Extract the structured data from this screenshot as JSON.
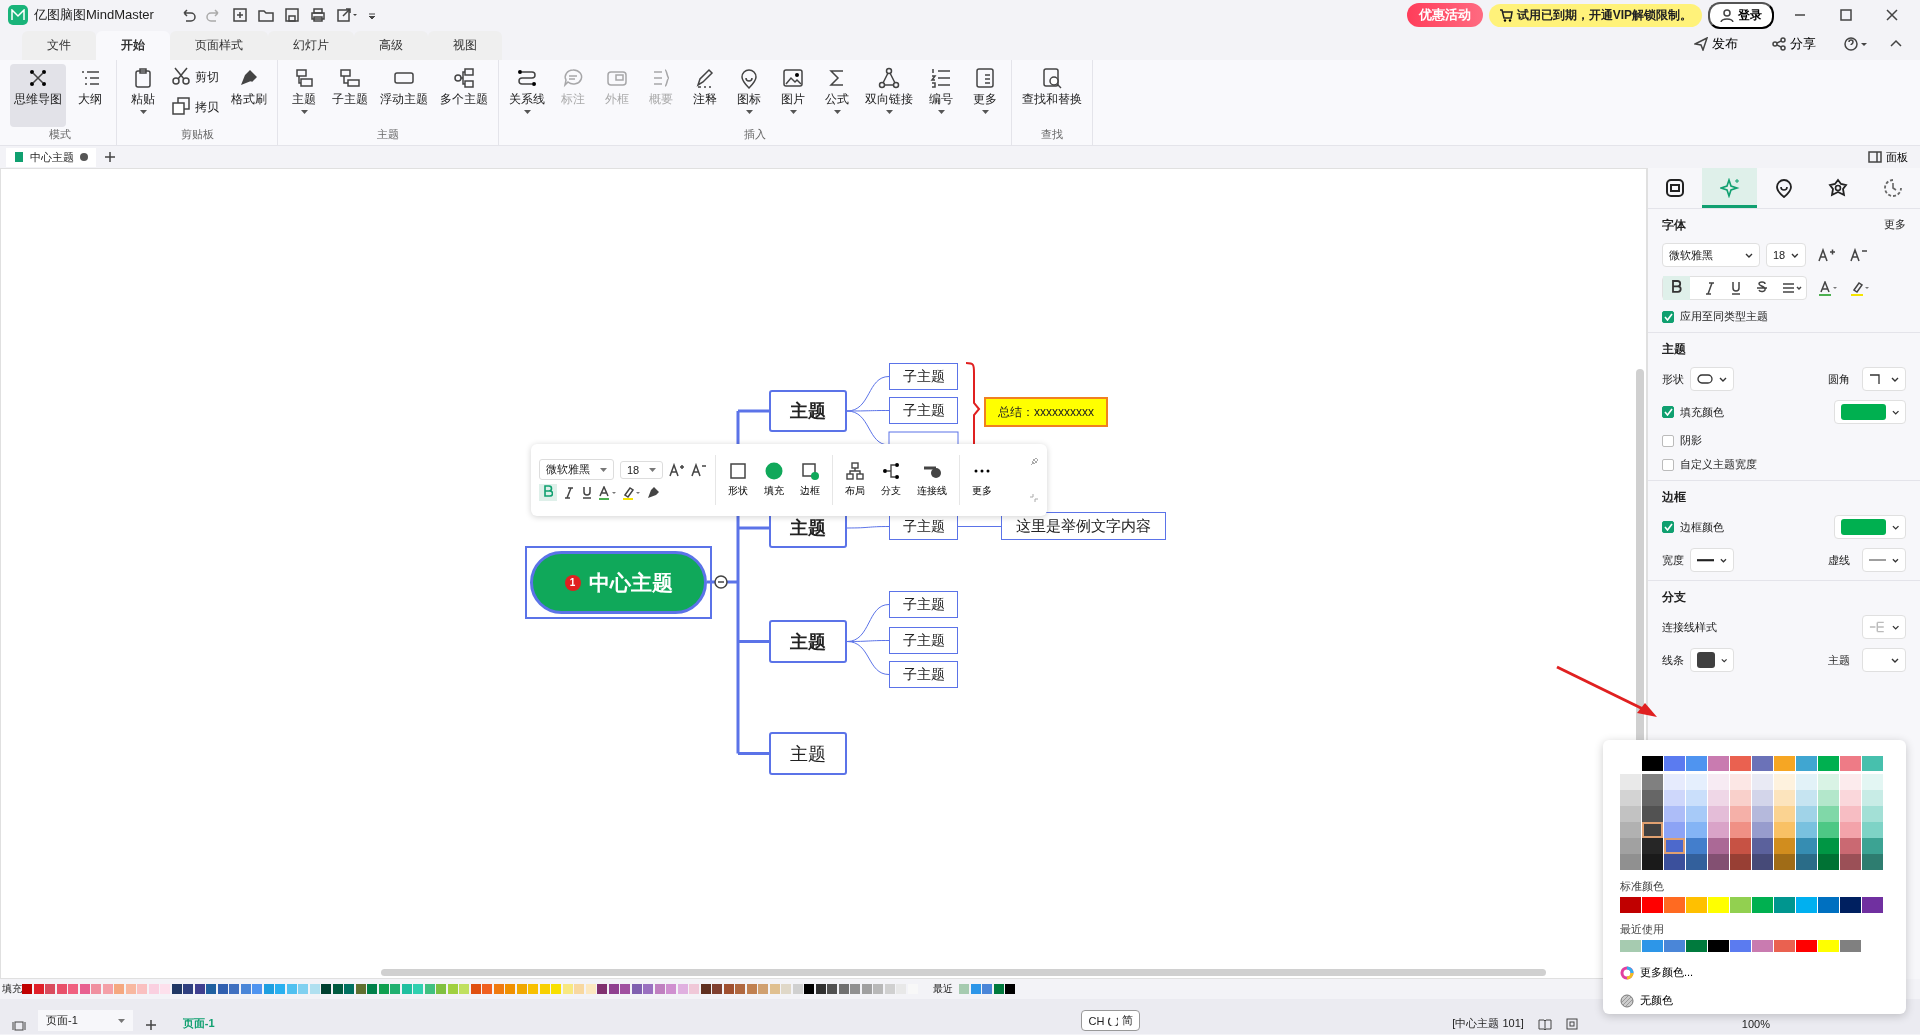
{
  "app": {
    "title": "亿图脑图MindMaster",
    "promo": "优惠活动",
    "trial": "试用已到期，开通VIP解锁限制。",
    "login": "登录",
    "publish": "发布",
    "share": "分享"
  },
  "menu": [
    {
      "label": "文件",
      "selected": false
    },
    {
      "label": "开始",
      "selected": true
    },
    {
      "label": "页面样式",
      "selected": false
    },
    {
      "label": "幻灯片",
      "selected": false
    },
    {
      "label": "高级",
      "selected": false
    },
    {
      "label": "视图",
      "selected": false
    }
  ],
  "ribbon": [
    {
      "label": "模式",
      "buttons": [
        {
          "label": "思维导图",
          "kind": "large",
          "selected": true,
          "disabled": false,
          "dropdown": false
        },
        {
          "label": "大纲",
          "kind": "large",
          "selected": false,
          "disabled": false,
          "dropdown": false
        }
      ]
    },
    {
      "label": "剪贴板",
      "buttons": [
        {
          "label": "粘贴",
          "kind": "large",
          "selected": false,
          "disabled": false,
          "dropdown": true
        },
        {
          "label": "剪切",
          "kind": "small",
          "selected": false,
          "disabled": false,
          "dropdown": false
        },
        {
          "label": "拷贝",
          "kind": "small",
          "selected": false,
          "disabled": false,
          "dropdown": false
        },
        {
          "label": "格式刷",
          "kind": "large",
          "selected": false,
          "disabled": false,
          "dropdown": false
        }
      ]
    },
    {
      "label": "主题",
      "buttons": [
        {
          "label": "主题",
          "kind": "large",
          "selected": false,
          "disabled": false,
          "dropdown": true
        },
        {
          "label": "子主题",
          "kind": "large",
          "selected": false,
          "disabled": false,
          "dropdown": false
        },
        {
          "label": "浮动主题",
          "kind": "large",
          "selected": false,
          "disabled": false,
          "dropdown": false
        },
        {
          "label": "多个主题",
          "kind": "large",
          "selected": false,
          "disabled": false,
          "dropdown": false
        }
      ]
    },
    {
      "label": "插入",
      "buttons": [
        {
          "label": "关系线",
          "kind": "large",
          "selected": false,
          "disabled": false,
          "dropdown": true
        },
        {
          "label": "标注",
          "kind": "large",
          "selected": false,
          "disabled": true,
          "dropdown": false
        },
        {
          "label": "外框",
          "kind": "large",
          "selected": false,
          "disabled": true,
          "dropdown": false
        },
        {
          "label": "概要",
          "kind": "large",
          "selected": false,
          "disabled": true,
          "dropdown": false
        },
        {
          "label": "注释",
          "kind": "large",
          "selected": false,
          "disabled": false,
          "dropdown": false
        },
        {
          "label": "图标",
          "kind": "large",
          "selected": false,
          "disabled": false,
          "dropdown": true
        },
        {
          "label": "图片",
          "kind": "large",
          "selected": false,
          "disabled": false,
          "dropdown": true
        },
        {
          "label": "公式",
          "kind": "large",
          "selected": false,
          "disabled": false,
          "dropdown": true
        },
        {
          "label": "双向链接",
          "kind": "large",
          "selected": false,
          "disabled": false,
          "dropdown": true
        },
        {
          "label": "编号",
          "kind": "large",
          "selected": false,
          "disabled": false,
          "dropdown": true
        },
        {
          "label": "更多",
          "kind": "large",
          "selected": false,
          "disabled": false,
          "dropdown": true
        }
      ]
    },
    {
      "label": "查找",
      "buttons": [
        {
          "label": "查找和替换",
          "kind": "large",
          "selected": false,
          "disabled": false,
          "dropdown": false
        }
      ]
    }
  ],
  "doc_tabs": [
    {
      "label": "中心主题",
      "modified": true,
      "selected": true
    }
  ],
  "panel_toggle": "面板",
  "mindmap": {
    "central": {
      "text": "中心主题",
      "badge": "1"
    },
    "topics": [
      {
        "text": "主题",
        "bold": true,
        "children": [
          {
            "text": "子主题"
          },
          {
            "text": "子主题"
          }
        ],
        "summary": "总结：xxxxxxxxxx"
      },
      {
        "text": "主题",
        "bold": true,
        "children": [
          {
            "text": "子主题",
            "children": [
              {
                "text": "这里是举例文字内容"
              }
            ]
          }
        ]
      },
      {
        "text": "主题",
        "bold": true,
        "children": [
          {
            "text": "子主题"
          },
          {
            "text": "子主题"
          },
          {
            "text": "子主题"
          }
        ]
      },
      {
        "text": "主题",
        "bold": false
      }
    ]
  },
  "float_toolbar": {
    "font": "微软雅黑",
    "size": "18",
    "bold_on": true,
    "tools": [
      {
        "label": "形状"
      },
      {
        "label": "填充"
      },
      {
        "label": "边框"
      },
      {
        "label": "布局"
      },
      {
        "label": "分支"
      },
      {
        "label": "连接线"
      },
      {
        "label": "更多"
      }
    ]
  },
  "panel": {
    "tabs": [
      {
        "selected": false
      },
      {
        "selected": true
      },
      {
        "selected": false
      },
      {
        "selected": false
      },
      {
        "selected": false
      }
    ],
    "font": {
      "title": "字体",
      "more": "更多",
      "font": "微软雅黑",
      "size": "18",
      "bold_on": true,
      "apply": {
        "label": "应用至同类型主题",
        "checked": true
      }
    },
    "topic": {
      "title": "主题",
      "shape_label": "形状",
      "corner_label": "圆角",
      "fill": {
        "label": "填充颜色",
        "checked": true,
        "color": "#00b050"
      },
      "shadow": {
        "label": "阴影",
        "checked": false
      },
      "custom_width": {
        "label": "自定义主题宽度",
        "checked": false
      }
    },
    "border": {
      "title": "边框",
      "color": {
        "label": "边框颜色",
        "checked": true,
        "color": "#00b050"
      },
      "width_label": "宽度",
      "dash_label": "虚线"
    },
    "branch": {
      "title": "分支",
      "connector_label": "连接线样式",
      "line": {
        "label": "线条",
        "color": "#404040"
      },
      "topic_label": "主题"
    }
  },
  "picker": {
    "theme": [
      {
        "color": "#000000"
      },
      {
        "color": "#5b7bf0"
      },
      {
        "color": "#4f94f0"
      },
      {
        "color": "#c97bb0"
      },
      {
        "color": "#ea6150"
      },
      {
        "color": "#6b72b8"
      },
      {
        "color": "#f6a623"
      },
      {
        "color": "#40a6d1"
      },
      {
        "color": "#00b050"
      },
      {
        "color": "#ee7b86"
      },
      {
        "color": "#47c0ad"
      }
    ],
    "standard_label": "标准颜色",
    "standard": [
      {
        "color": "#c00000"
      },
      {
        "color": "#ff0000"
      },
      {
        "color": "#ff6a21"
      },
      {
        "color": "#ffc000"
      },
      {
        "color": "#ffff00"
      },
      {
        "color": "#92d050"
      },
      {
        "color": "#00b050"
      },
      {
        "color": "#00968f"
      },
      {
        "color": "#00b0f0"
      },
      {
        "color": "#0070c0"
      },
      {
        "color": "#002060"
      },
      {
        "color": "#7030a0"
      }
    ],
    "recent_label": "最近使用",
    "recent": [
      {
        "color": "#a6cbb0"
      },
      {
        "color": "#2d96e8"
      },
      {
        "color": "#4a86d8"
      },
      {
        "color": "#007a3d"
      },
      {
        "color": "#000000"
      },
      {
        "color": "#5b7bf0"
      },
      {
        "color": "#c97bb0"
      },
      {
        "color": "#ea6150"
      },
      {
        "color": "#ff0000"
      },
      {
        "color": "#ffff00"
      },
      {
        "color": "#808080"
      }
    ],
    "more": "更多颜色...",
    "none": "无颜色"
  },
  "fill_strip": {
    "label": "填充",
    "recent_label": "最近",
    "colors": [
      {
        "color": "#c00000"
      },
      {
        "color": "#e0202a"
      },
      {
        "color": "#d94c5e"
      },
      {
        "color": "#e8506a"
      },
      {
        "color": "#f06080"
      },
      {
        "color": "#e86090"
      },
      {
        "color": "#f090a0"
      },
      {
        "color": "#f4a0a8"
      },
      {
        "color": "#f5a880"
      },
      {
        "color": "#f8b8a0"
      },
      {
        "color": "#fac0c0"
      },
      {
        "color": "#fad0e0"
      },
      {
        "color": "#fde0ec"
      },
      {
        "color": "#203864"
      },
      {
        "color": "#2f3f7f"
      },
      {
        "color": "#3f3f8f"
      },
      {
        "color": "#2060a0"
      },
      {
        "color": "#305fb0"
      },
      {
        "color": "#4070c0"
      },
      {
        "color": "#4a86d8"
      },
      {
        "color": "#4f94f0"
      },
      {
        "color": "#1e9fe0"
      },
      {
        "color": "#2ab0f0"
      },
      {
        "color": "#50c0f0"
      },
      {
        "color": "#80d0f0"
      },
      {
        "color": "#b0e0f0"
      },
      {
        "color": "#004030"
      },
      {
        "color": "#005a40"
      },
      {
        "color": "#007060"
      },
      {
        "color": "#607030"
      },
      {
        "color": "#00804a"
      },
      {
        "color": "#10a050"
      },
      {
        "color": "#20b070"
      },
      {
        "color": "#20c0a0"
      },
      {
        "color": "#30d0b0"
      },
      {
        "color": "#40c080"
      },
      {
        "color": "#80c040"
      },
      {
        "color": "#a0d040"
      },
      {
        "color": "#c0e060"
      },
      {
        "color": "#e05010"
      },
      {
        "color": "#f06020"
      },
      {
        "color": "#f07a10"
      },
      {
        "color": "#f09000"
      },
      {
        "color": "#f0a800"
      },
      {
        "color": "#f8c000"
      },
      {
        "color": "#f8d000"
      },
      {
        "color": "#f8e000"
      },
      {
        "color": "#f8e880"
      },
      {
        "color": "#f8d8a0"
      },
      {
        "color": "#fce8c0"
      },
      {
        "color": "#803070"
      },
      {
        "color": "#904090"
      },
      {
        "color": "#a050a0"
      },
      {
        "color": "#8060b0"
      },
      {
        "color": "#9a70c0"
      },
      {
        "color": "#c080c0"
      },
      {
        "color": "#d090d0"
      },
      {
        "color": "#e0b0e0"
      },
      {
        "color": "#f0c8d8"
      },
      {
        "color": "#603020"
      },
      {
        "color": "#804030"
      },
      {
        "color": "#a05030"
      },
      {
        "color": "#b06840"
      },
      {
        "color": "#c08050"
      },
      {
        "color": "#d0a070"
      },
      {
        "color": "#e0c090"
      },
      {
        "color": "#e0d8c8"
      },
      {
        "color": "#d0d0d0"
      },
      {
        "color": "#000000"
      },
      {
        "color": "#303030"
      },
      {
        "color": "#505050"
      },
      {
        "color": "#707070"
      },
      {
        "color": "#909090"
      },
      {
        "color": "#a0a0a0"
      },
      {
        "color": "#b8b8b8"
      },
      {
        "color": "#d0d0d0"
      },
      {
        "color": "#e8e8e8"
      },
      {
        "color": "#f8f8f8"
      }
    ],
    "recent": [
      {
        "color": "#a6cbb0"
      },
      {
        "color": "#2d96e8"
      },
      {
        "color": "#4a86d8"
      },
      {
        "color": "#007a3d"
      },
      {
        "color": "#000000"
      }
    ]
  },
  "status": {
    "page_select": "页面-1",
    "pages": [
      {
        "label": "页面-1",
        "selected": true
      }
    ],
    "ime_lang": "CH",
    "ime_mode": "简",
    "selection": "[中心主题 101]",
    "zoom": "100%"
  }
}
